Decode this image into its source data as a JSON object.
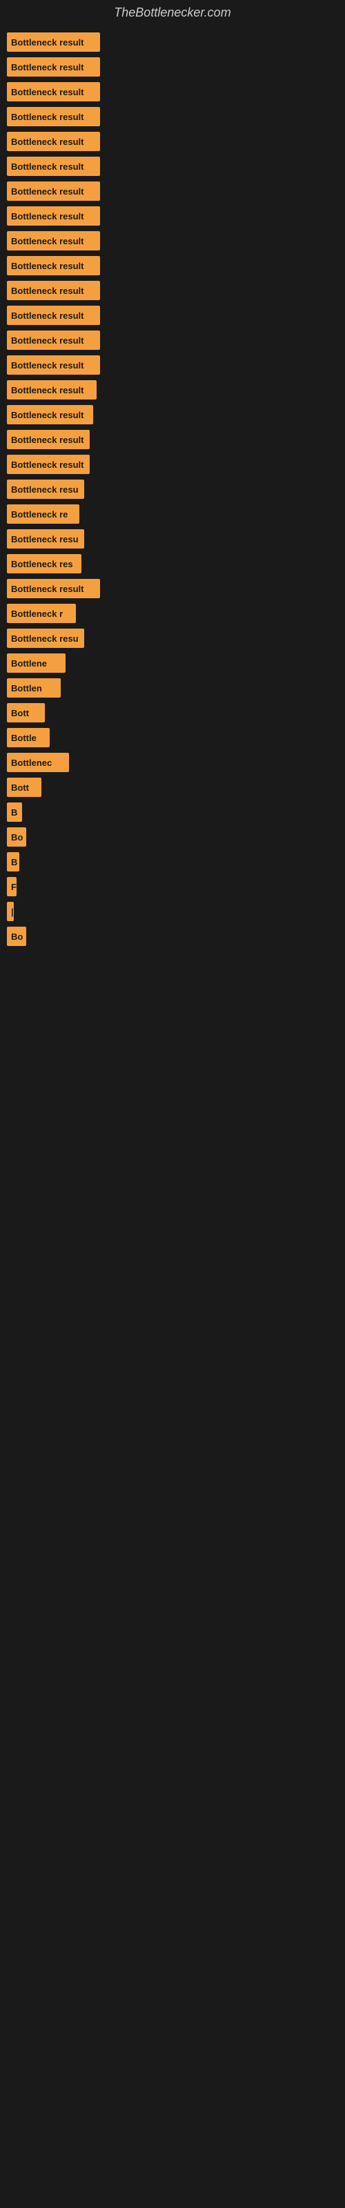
{
  "site": {
    "title": "TheBottlenecker.com"
  },
  "bars": [
    {
      "label": "Bottleneck result",
      "width": 135
    },
    {
      "label": "Bottleneck result",
      "width": 135
    },
    {
      "label": "Bottleneck result",
      "width": 135
    },
    {
      "label": "Bottleneck result",
      "width": 135
    },
    {
      "label": "Bottleneck result",
      "width": 135
    },
    {
      "label": "Bottleneck result",
      "width": 135
    },
    {
      "label": "Bottleneck result",
      "width": 135
    },
    {
      "label": "Bottleneck result",
      "width": 135
    },
    {
      "label": "Bottleneck result",
      "width": 135
    },
    {
      "label": "Bottleneck result",
      "width": 135
    },
    {
      "label": "Bottleneck result",
      "width": 135
    },
    {
      "label": "Bottleneck result",
      "width": 135
    },
    {
      "label": "Bottleneck result",
      "width": 135
    },
    {
      "label": "Bottleneck result",
      "width": 135
    },
    {
      "label": "Bottleneck result",
      "width": 130
    },
    {
      "label": "Bottleneck result",
      "width": 125
    },
    {
      "label": "Bottleneck result",
      "width": 120
    },
    {
      "label": "Bottleneck result",
      "width": 120
    },
    {
      "label": "Bottleneck resu",
      "width": 112
    },
    {
      "label": "Bottleneck re",
      "width": 105
    },
    {
      "label": "Bottleneck resu",
      "width": 112
    },
    {
      "label": "Bottleneck res",
      "width": 108
    },
    {
      "label": "Bottleneck result",
      "width": 135
    },
    {
      "label": "Bottleneck r",
      "width": 100
    },
    {
      "label": "Bottleneck resu",
      "width": 112
    },
    {
      "label": "Bottlene",
      "width": 85
    },
    {
      "label": "Bottlen",
      "width": 78
    },
    {
      "label": "Bott",
      "width": 55
    },
    {
      "label": "Bottle",
      "width": 62
    },
    {
      "label": "Bottlenec",
      "width": 90
    },
    {
      "label": "Bott",
      "width": 50
    },
    {
      "label": "B",
      "width": 22
    },
    {
      "label": "Bo",
      "width": 28
    },
    {
      "label": "B",
      "width": 18
    },
    {
      "label": "F",
      "width": 14
    },
    {
      "label": "|",
      "width": 10
    },
    {
      "label": "Bo",
      "width": 28
    }
  ]
}
